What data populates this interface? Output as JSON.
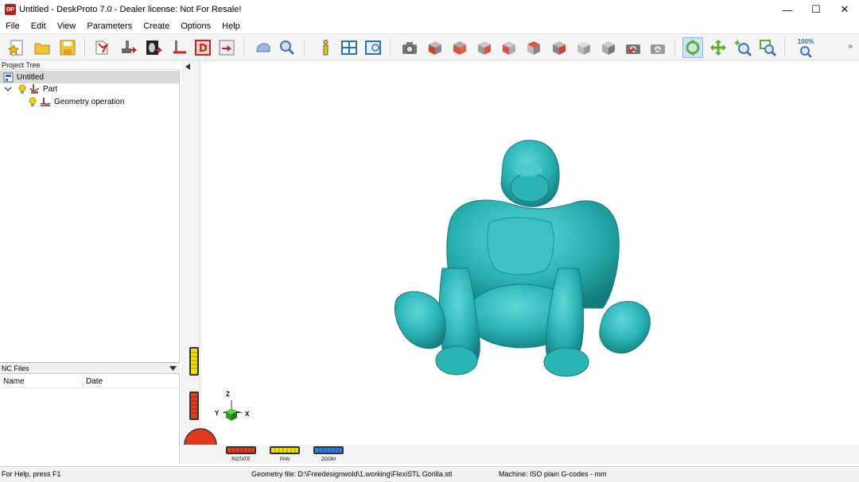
{
  "window": {
    "app_icon": "DP",
    "title": "Untitled - DeskProto 7.0 - Dealer license: Not For Resale!",
    "minimize": "—",
    "maximize": "☐",
    "close": "✕"
  },
  "menu": [
    "File",
    "Edit",
    "View",
    "Parameters",
    "Create",
    "Options",
    "Help"
  ],
  "toolbar": {
    "zoom_level": "100%",
    "buttons": [
      "new-icon",
      "open-icon",
      "save-icon",
      "wizard-icon",
      "part-icon",
      "image-icon",
      "operation-icon",
      "drawing-icon",
      "export-icon",
      "part-shape-icon",
      "preview-icon",
      "info-icon",
      "layout-icon",
      "views-icon",
      "camera-icon",
      "cube-front-icon",
      "cube-top-icon",
      "cube-right-icon",
      "cube-left-icon",
      "cube-back-icon",
      "cube-bottom-icon",
      "cube-iso1-icon",
      "cube-iso2-icon",
      "camera-undo-icon",
      "camera-redo-icon",
      "rotate-tool-icon",
      "pan-tool-icon",
      "zoom-tool-icon",
      "zoom-window-icon",
      "zoom-100-icon"
    ]
  },
  "project_tree": {
    "header": "Project Tree",
    "items": [
      {
        "label": "Untitled",
        "icon": "project-icon",
        "level": 0
      },
      {
        "label": "Part",
        "icon": "part-icon",
        "level": 1
      },
      {
        "label": "Geometry operation",
        "icon": "operation-icon",
        "level": 2
      }
    ]
  },
  "nc_files": {
    "header": "NC Files",
    "columns": [
      "Name",
      "Date"
    ]
  },
  "viewport": {
    "axes": {
      "x": "X",
      "y": "Y",
      "z": "Z"
    },
    "slider_labels": {
      "rotate": "ROTATE",
      "pan": "PAN",
      "zoom": "ZOOM"
    },
    "model_color": "#2bb5b5"
  },
  "status": {
    "help": "For Help, press F1",
    "geometry": "Geometry file: D:\\Freedesignwold\\1.working\\FlexiSTL Gorilla.stl",
    "machine": "Machine: ISO plain G-codes - mm"
  }
}
